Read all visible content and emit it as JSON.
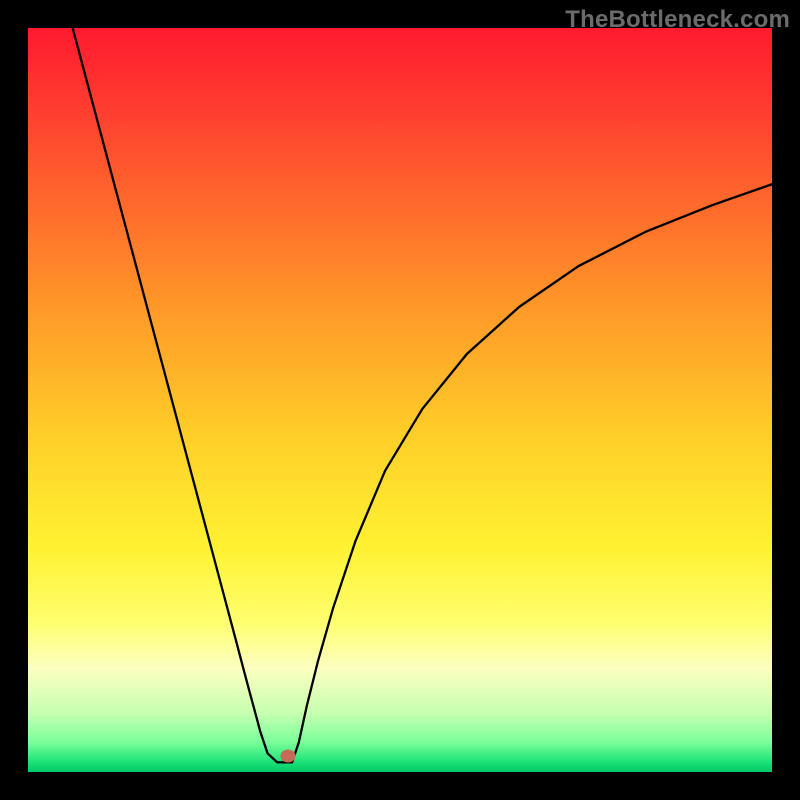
{
  "watermark": "TheBottleneck.com",
  "colors": {
    "frame": "#000000",
    "curve": "#000000",
    "dot": "#c66a5a"
  },
  "chart_data": {
    "type": "line",
    "title": "",
    "xlabel": "",
    "ylabel": "",
    "xlim": [
      0,
      100
    ],
    "ylim": [
      0,
      100
    ],
    "grid": false,
    "legend": false,
    "series": [
      {
        "name": "left-branch",
        "x": [
          6,
          8,
          10,
          12,
          14,
          16,
          18,
          20,
          22,
          24,
          26,
          28,
          29,
          29.8,
          30.4,
          31.2,
          32.2,
          33.5
        ],
        "y": [
          100,
          92.5,
          85,
          77.5,
          70,
          62.5,
          55,
          47.5,
          40,
          32.5,
          25,
          17.5,
          13.7,
          10.7,
          8.5,
          5.5,
          2.5,
          1.3
        ]
      },
      {
        "name": "plateau",
        "x": [
          33.5,
          34.4,
          35.5
        ],
        "y": [
          1.3,
          1.3,
          1.3
        ]
      },
      {
        "name": "right-branch",
        "x": [
          35.5,
          36.4,
          37.5,
          39,
          41,
          44,
          48,
          53,
          59,
          66,
          74,
          83,
          92,
          100
        ],
        "y": [
          1.3,
          4,
          9,
          15,
          22,
          31,
          40.5,
          48.8,
          56.2,
          62.5,
          68,
          72.6,
          76.2,
          79
        ]
      }
    ],
    "annotations": [
      {
        "name": "dot",
        "x": 35,
        "y": 2.2
      }
    ]
  }
}
